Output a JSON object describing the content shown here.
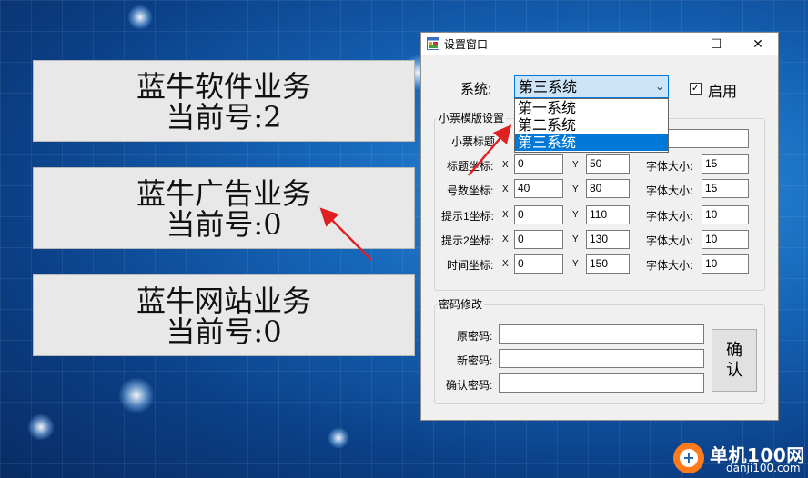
{
  "colors": {
    "accent": "#0078d7",
    "arrow": "#e02020",
    "window_bg": "#f0f0f0",
    "panel_bg": "#e8e8e8"
  },
  "business_panels": [
    {
      "name": "蓝牛软件业务",
      "number": "当前号:2"
    },
    {
      "name": "蓝牛广告业务",
      "number": "当前号:0"
    },
    {
      "name": "蓝牛网站业务",
      "number": "当前号:0"
    }
  ],
  "window": {
    "title": "设置窗口",
    "icon": "app-form-icon",
    "controls": {
      "minimize": "—",
      "maximize": "☐",
      "close": "✕"
    },
    "system_label": "系统:",
    "system_selected": "第三系统",
    "system_options": [
      "第一系统",
      "第二系统",
      "第三系统"
    ],
    "enable_label": "启用",
    "enable_checked": true,
    "ticket_group_title": "小票模版设置",
    "ticket_title_label": "小票标题",
    "ticket_title_value": "",
    "x_label": "X",
    "y_label": "Y",
    "font_size_label": "字体大小:",
    "coordinate_rows": [
      {
        "label": "标题坐标:",
        "x": "0",
        "y": "50",
        "font_size": "15"
      },
      {
        "label": "号数坐标:",
        "x": "40",
        "y": "80",
        "font_size": "15"
      },
      {
        "label": "提示1坐标:",
        "x": "0",
        "y": "110",
        "font_size": "10"
      },
      {
        "label": "提示2坐标:",
        "x": "0",
        "y": "130",
        "font_size": "10"
      },
      {
        "label": "时间坐标:",
        "x": "0",
        "y": "150",
        "font_size": "10"
      }
    ],
    "password_group_title": "密码修改",
    "old_password_label": "原密码:",
    "new_password_label": "新密码:",
    "confirm_password_label": "确认密码:",
    "confirm_button_line1": "确",
    "confirm_button_line2": "认"
  },
  "watermark": {
    "brand": "单机100网",
    "url": "danji100.com",
    "logo_glyph": "+"
  }
}
